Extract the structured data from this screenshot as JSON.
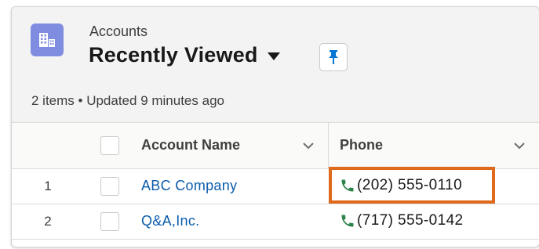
{
  "header": {
    "object_label": "Accounts",
    "list_view_name": "Recently Viewed",
    "status_text": "2 items • Updated 9 minutes ago",
    "icon": "accounts-building-icon",
    "pin_icon": "pin-icon"
  },
  "columns": [
    {
      "label": "Account Name"
    },
    {
      "label": "Phone"
    }
  ],
  "rows": [
    {
      "num": "1",
      "account_name": "ABC Company",
      "phone": "(202) 555-0110"
    },
    {
      "num": "2",
      "account_name": "Q&A,Inc.",
      "phone": "(717) 555-0142"
    }
  ],
  "colors": {
    "brand_icon_bg": "#7f8de1",
    "link": "#0b5cab",
    "phone_icon": "#2e844a",
    "pin_icon": "#0176d3",
    "highlight": "#e06a1b"
  }
}
